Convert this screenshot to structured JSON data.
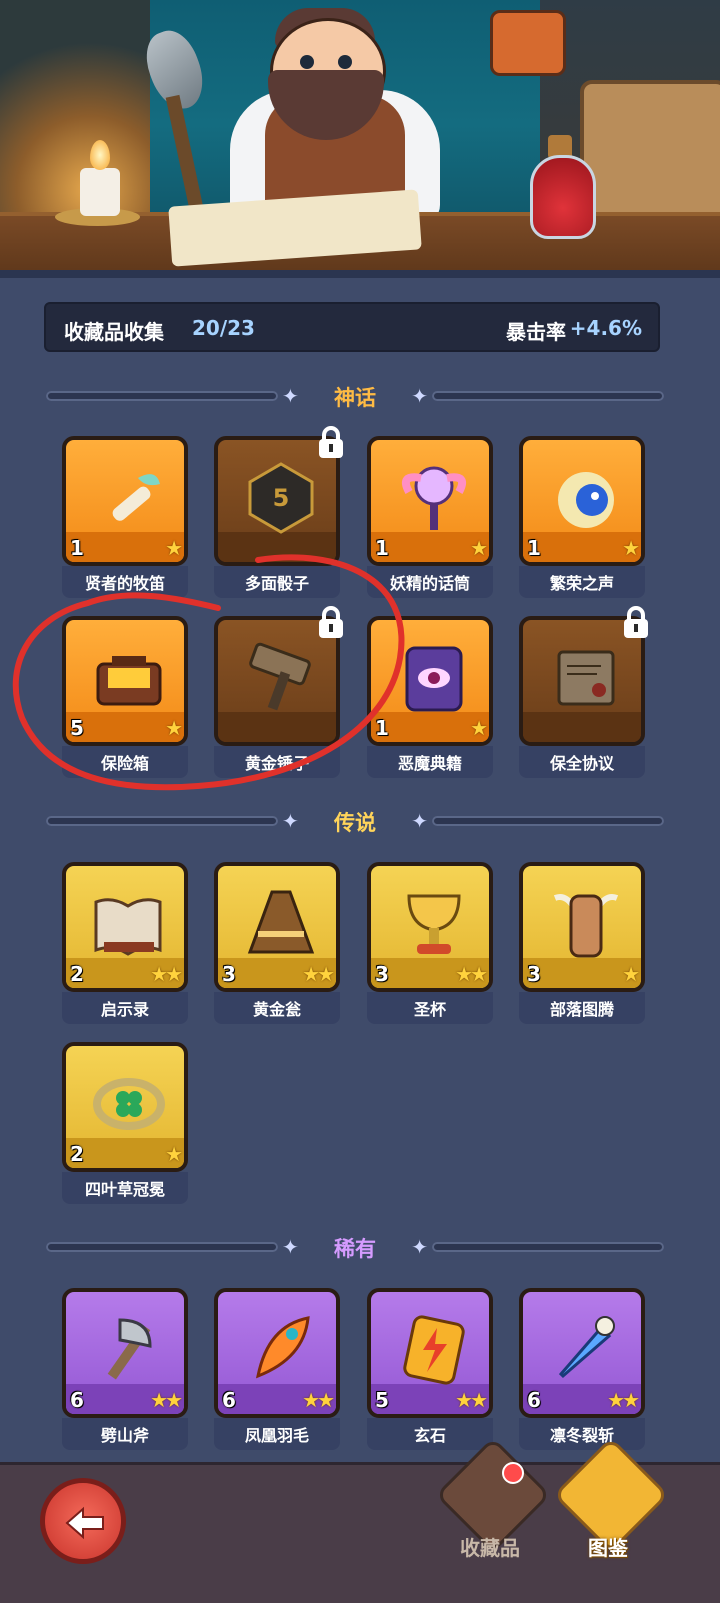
{
  "collection": {
    "label": "收藏品收集",
    "count": "20/23",
    "crit_label": "暴击率",
    "crit_value": "+4.6%"
  },
  "sections": {
    "myth": "神话",
    "legend": "传说",
    "rare": "稀有"
  },
  "myth_items": [
    {
      "name": "贤者的牧笛",
      "level": "1",
      "stars": 1,
      "locked": false,
      "icon": "flute-icon"
    },
    {
      "name": "多面骰子",
      "level": "",
      "stars": 0,
      "locked": true,
      "icon": "dice-icon"
    },
    {
      "name": "妖精的话筒",
      "level": "1",
      "stars": 1,
      "locked": false,
      "icon": "microphone-icon"
    },
    {
      "name": "繁荣之声",
      "level": "1",
      "stars": 1,
      "locked": false,
      "icon": "moon-orb-icon"
    },
    {
      "name": "保险箱",
      "level": "5",
      "stars": 1,
      "locked": false,
      "icon": "treasure-chest-icon"
    },
    {
      "name": "黄金锤子",
      "level": "",
      "stars": 0,
      "locked": true,
      "icon": "hammer-icon"
    },
    {
      "name": "恶魔典籍",
      "level": "1",
      "stars": 1,
      "locked": false,
      "icon": "demon-book-icon"
    },
    {
      "name": "保全协议",
      "level": "",
      "stars": 0,
      "locked": true,
      "icon": "scroll-icon"
    }
  ],
  "legend_items": [
    {
      "name": "启示录",
      "level": "2",
      "stars": 2,
      "icon": "open-book-icon"
    },
    {
      "name": "黄金瓮",
      "level": "3",
      "stars": 2,
      "icon": "urn-icon"
    },
    {
      "name": "圣杯",
      "level": "3",
      "stars": 2,
      "icon": "grail-icon"
    },
    {
      "name": "部落图腾",
      "level": "3",
      "stars": 1,
      "icon": "totem-icon"
    },
    {
      "name": "四叶草冠冕",
      "level": "2",
      "stars": 1,
      "icon": "clover-crown-icon"
    }
  ],
  "rare_items": [
    {
      "name": "劈山斧",
      "level": "6",
      "stars": 2,
      "icon": "axe-icon"
    },
    {
      "name": "凤凰羽毛",
      "level": "6",
      "stars": 2,
      "icon": "phoenix-feather-icon"
    },
    {
      "name": "玄石",
      "level": "5",
      "stars": 2,
      "icon": "lightning-stone-icon"
    },
    {
      "name": "凛冬裂斩",
      "level": "6",
      "stars": 2,
      "icon": "frost-sword-icon"
    }
  ],
  "nav": {
    "collect_label": "收藏品",
    "guide_label": "图鉴"
  },
  "colors": {
    "background": "#3f4b6a",
    "myth_tile": "#f38a17",
    "legend_tile": "#e3b530",
    "rare_tile": "#9458d4",
    "locked_tile": "#6a3d19",
    "annotation": "#e0312b"
  }
}
